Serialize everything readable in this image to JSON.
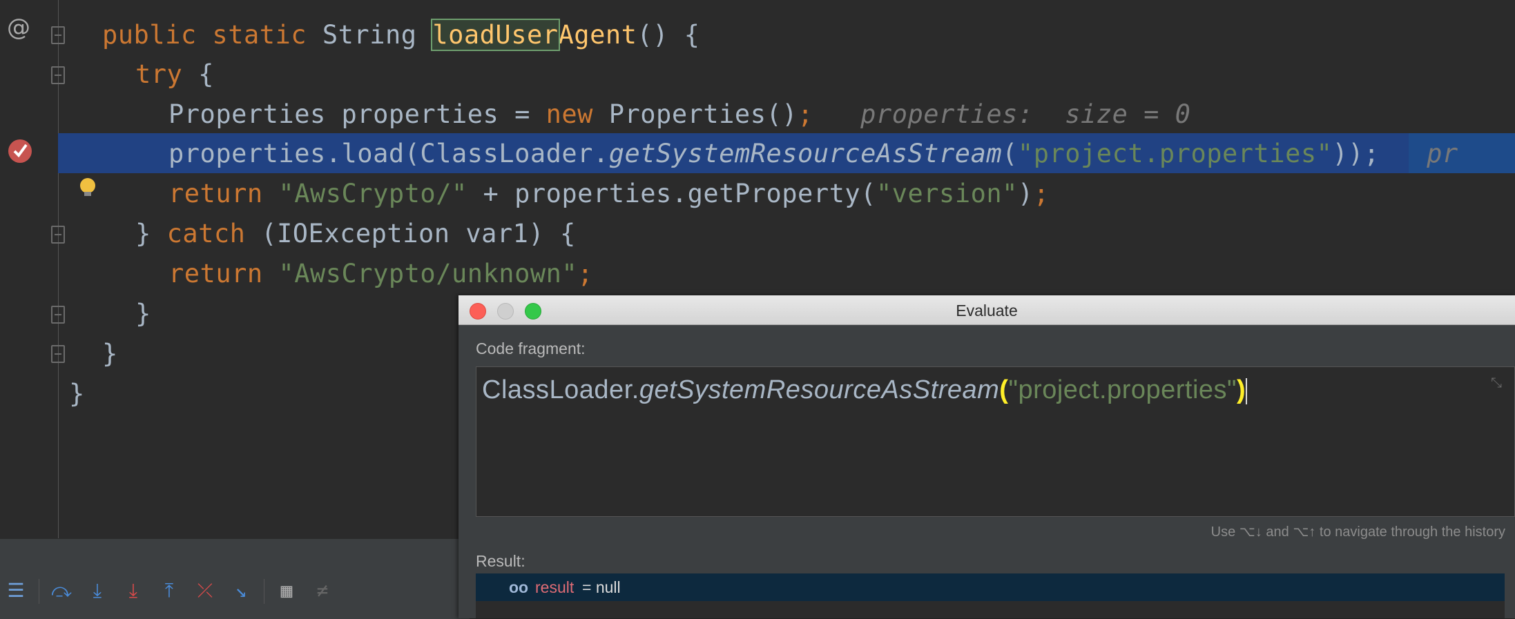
{
  "editor": {
    "gutter_at": "@",
    "lines": {
      "l1": {
        "kw": "public static",
        "type": " String ",
        "method_match": "loadUser",
        "method_rest": "Agent",
        "rest": "() {"
      },
      "l2": {
        "kw": "try",
        "rest": " {"
      },
      "l3": {
        "pre": "Properties properties = ",
        "kw": "new",
        "post": " Properties()",
        "semi": ";",
        "hint": "properties:  size = 0"
      },
      "l4": {
        "pre": "properties.load(ClassLoader.",
        "call": "getSystemResourceAsStream",
        "open": "(",
        "str": "\"project.properties\"",
        "close": "));",
        "hint": "pr"
      },
      "l5": {
        "kw": "return",
        "str": " \"AwsCrypto/\"",
        "mid": " + properties.getProperty(",
        "str2": "\"version\"",
        "close": ")",
        "semi": ";"
      },
      "l6": {
        "brace": "} ",
        "kw": "catch",
        "rest": " (IOException var1) {"
      },
      "l7": {
        "kw": "return",
        "str": " \"AwsCrypto/unknown\"",
        "semi": ";"
      },
      "l8": {
        "rest": "}"
      },
      "l9": {
        "rest": "}"
      },
      "l10": {
        "rest": "}"
      }
    }
  },
  "toolbar": {
    "icons": [
      "list-icon",
      "step-over-icon",
      "step-into-icon",
      "force-step-into-icon",
      "step-out-icon",
      "drop-frame-icon",
      "run-to-cursor-icon",
      "evaluate-icon",
      "trace-icon"
    ]
  },
  "dialog": {
    "title": "Evaluate",
    "code_fragment_label": "Code fragment:",
    "code": {
      "pre": "ClassLoader.",
      "call": "getSystemResourceAsStream",
      "open": "(",
      "str": "\"project.properties\"",
      "close": ")"
    },
    "history_hint": "Use ⌥↓ and ⌥↑ to navigate through the history",
    "result_label": "Result:",
    "result": {
      "icon": "oo",
      "name": "result",
      "eq": " = null"
    }
  },
  "colors": {
    "editor_bg": "#2b2b2b",
    "keyword": "#cc7832",
    "string": "#6a8759",
    "selection": "#214283",
    "breakpoint": "#c75450",
    "result_name": "#e06c75"
  }
}
